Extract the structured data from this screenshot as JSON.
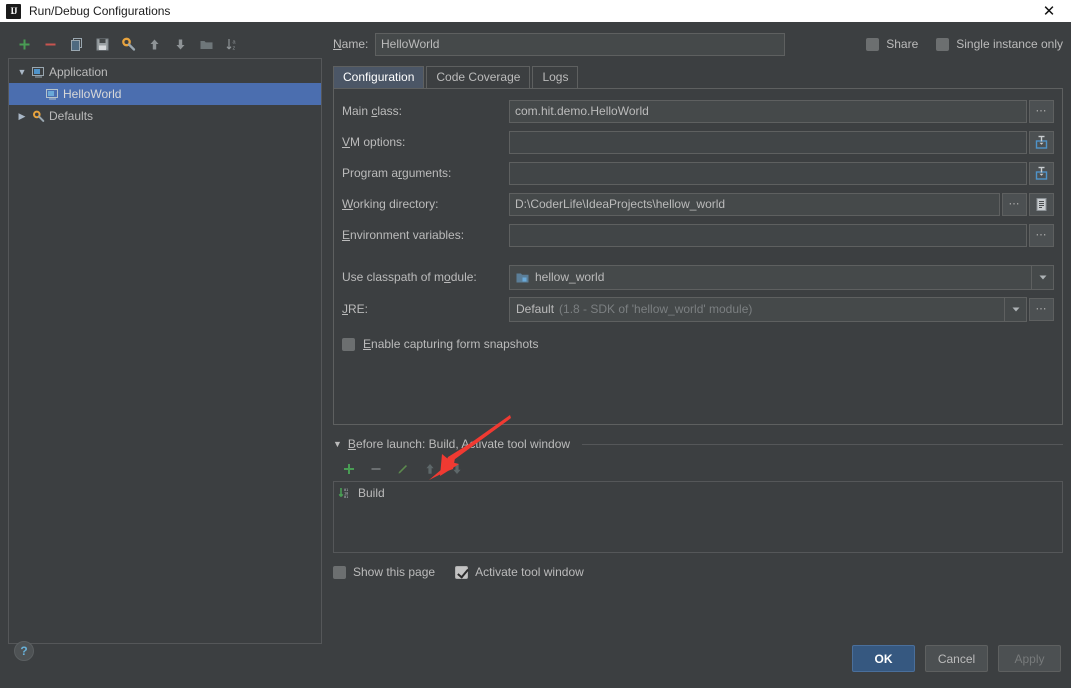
{
  "window": {
    "title": "Run/Debug Configurations",
    "app_icon": "intellij-idea-icon",
    "close_icon": "close-icon"
  },
  "left_panel": {
    "toolbar": [
      {
        "name": "add-configuration-button",
        "icon": "plus-icon",
        "label": "+"
      },
      {
        "name": "remove-configuration-button",
        "icon": "minus-icon",
        "label": "–"
      },
      {
        "name": "copy-configuration-button",
        "icon": "copy-icon",
        "label": ""
      },
      {
        "name": "save-configuration-button",
        "icon": "save-icon",
        "label": ""
      },
      {
        "name": "edit-defaults-button",
        "icon": "wrench-gear-icon",
        "label": ""
      },
      {
        "name": "move-up-button",
        "icon": "arrow-up-icon",
        "label": ""
      },
      {
        "name": "move-down-button",
        "icon": "arrow-down-icon",
        "label": ""
      },
      {
        "name": "move-into-folder-button",
        "icon": "folder-icon",
        "label": ""
      },
      {
        "name": "sort-configurations-button",
        "icon": "sort-az-icon",
        "label": ""
      }
    ],
    "tree": [
      {
        "name": "tree-node-application",
        "label": "Application",
        "twisty": "▼",
        "icon": "application-icon",
        "selected": false,
        "indent": false
      },
      {
        "name": "tree-node-helloworld",
        "label": "HelloWorld",
        "twisty": "",
        "icon": "application-icon",
        "selected": true,
        "indent": true
      },
      {
        "name": "tree-node-defaults",
        "label": "Defaults",
        "twisty": "▶",
        "icon": "wrench-gear-icon",
        "selected": false,
        "indent": false
      }
    ]
  },
  "right_panel": {
    "name_label": "Name:",
    "name_value": "HelloWorld",
    "share_label": "Share",
    "share_checked": false,
    "single_instance_label": "Single instance only",
    "single_instance_checked": false,
    "tabs": [
      {
        "label": "Configuration",
        "active": true
      },
      {
        "label": "Code Coverage",
        "active": false
      },
      {
        "label": "Logs",
        "active": false
      }
    ],
    "fields": {
      "main_class_label": "Main class:",
      "main_class_value": "com.hit.demo.HelloWorld",
      "vm_options_label": "VM options:",
      "vm_options_value": "",
      "program_arguments_label": "Program arguments:",
      "program_arguments_value": "",
      "working_directory_label": "Working directory:",
      "working_directory_value": "D:\\CoderLife\\IdeaProjects\\hellow_world",
      "environment_variables_label": "Environment variables:",
      "environment_variables_value": "",
      "use_classpath_label": "Use classpath of module:",
      "use_classpath_value": "hellow_world",
      "jre_label": "JRE:",
      "jre_value": "Default",
      "jre_value_detail": "(1.8 - SDK of 'hellow_world' module)"
    },
    "snapshots": {
      "label": "Enable capturing form snapshots",
      "checked": false
    },
    "before_launch": {
      "title": "Before launch: Build, Activate tool window",
      "twisty": "▼",
      "toolbar": [
        {
          "name": "before-launch-add-button",
          "icon": "plus-icon",
          "label": "+"
        },
        {
          "name": "before-launch-remove-button",
          "icon": "minus-icon",
          "label": "–"
        },
        {
          "name": "before-launch-edit-button",
          "icon": "pencil-icon",
          "label": ""
        },
        {
          "name": "before-launch-move-up-button",
          "icon": "arrow-up-icon",
          "label": ""
        },
        {
          "name": "before-launch-move-down-button",
          "icon": "arrow-down-icon",
          "label": ""
        }
      ],
      "items": [
        {
          "name": "before-launch-item-build",
          "label": "Build",
          "icon": "build-icon"
        }
      ],
      "show_page_label": "Show this page",
      "show_page_checked": false,
      "activate_window_label": "Activate tool window",
      "activate_window_checked": true
    }
  },
  "bottom": {
    "help_label": "?",
    "ok_label": "OK",
    "cancel_label": "Cancel",
    "apply_label": "Apply",
    "apply_disabled": true
  },
  "annotation": {
    "type": "red-arrow",
    "color": "#f03a32"
  },
  "colors": {
    "background": "#3c3f41",
    "panel_border": "#555759",
    "selection": "#4b6eaf",
    "active_tab": "#4b5666",
    "primary_button": "#365880",
    "accent_green": "#499c54",
    "accent_red": "#c75450",
    "text": "#bbbbbb",
    "text_muted": "#7b7f81"
  }
}
